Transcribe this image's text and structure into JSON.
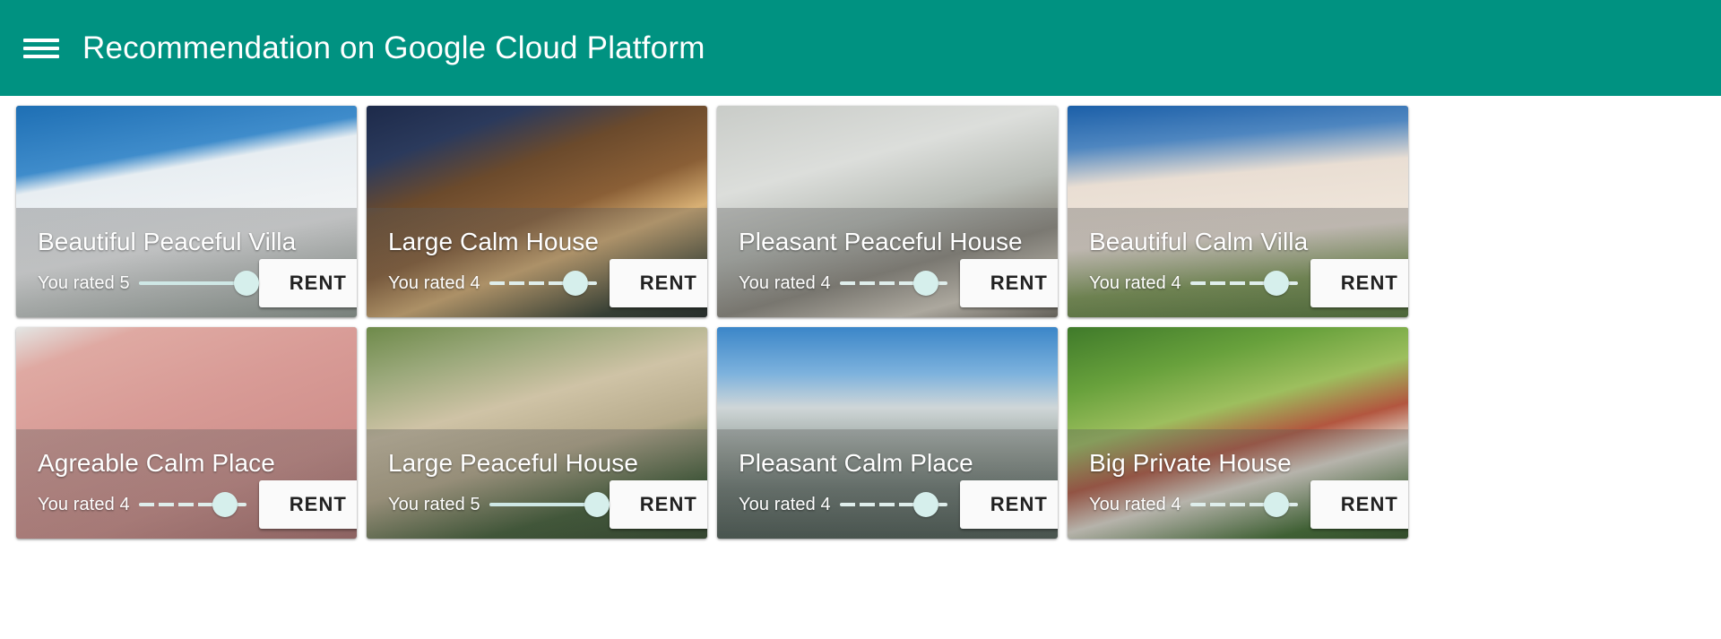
{
  "appbar": {
    "menu_icon": "hamburger-menu-icon",
    "title": "Recommendation on Google Cloud Platform",
    "background_color": "#009281",
    "title_color": "#ffffff"
  },
  "theme": {
    "accent": "#009281",
    "slider_thumb": "#d6efec",
    "slider_track": "#cfe8e6",
    "button_bg": "#fafafa",
    "button_text": "#212121"
  },
  "cards": [
    {
      "title": "Beautiful Peaceful Villa",
      "rating_label": "You rated 5",
      "rating": 5,
      "max_rating": 5,
      "action_label": "RENT",
      "photo": "snow-covered-white-villa-blue-sky"
    },
    {
      "title": "Large Calm House",
      "rating_label": "You rated 4",
      "rating": 4,
      "max_rating": 5,
      "action_label": "RENT",
      "photo": "modern-wood-house-lit-at-dusk"
    },
    {
      "title": "Pleasant Peaceful House",
      "rating_label": "You rated 4",
      "rating": 4,
      "max_rating": 5,
      "action_label": "RENT",
      "photo": "house-gable-roof-against-cloudy-sky"
    },
    {
      "title": "Beautiful Calm Villa",
      "rating_label": "You rated 4",
      "rating": 4,
      "max_rating": 5,
      "action_label": "RENT",
      "photo": "large-suburban-mansion-with-lawn"
    },
    {
      "title": "Agreable Calm Place",
      "rating_label": "You rated 4",
      "rating": 4,
      "max_rating": 5,
      "action_label": "RENT",
      "photo": "pink-wall-with-gooseneck-lamps"
    },
    {
      "title": "Large Peaceful House",
      "rating_label": "You rated 5",
      "rating": 5,
      "max_rating": 5,
      "action_label": "RENT",
      "photo": "stone-cottage-green-door-with-vines"
    },
    {
      "title": "Pleasant Calm Place",
      "rating_label": "You rated 4",
      "rating": 4,
      "max_rating": 5,
      "action_label": "RENT",
      "photo": "waterfront-houses-with-boat"
    },
    {
      "title": "Big Private House",
      "rating_label": "You rated 4",
      "rating": 4,
      "max_rating": 5,
      "action_label": "RENT",
      "photo": "red-roof-house-in-green-forest"
    }
  ]
}
